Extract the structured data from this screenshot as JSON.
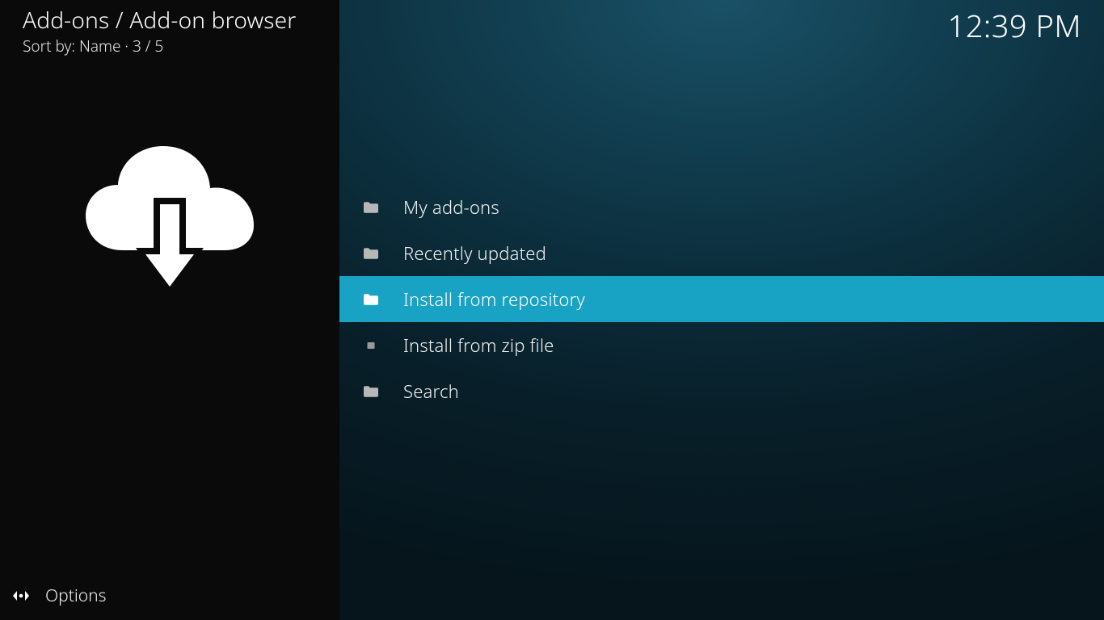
{
  "header": {
    "breadcrumb": "Add-ons / Add-on browser",
    "sort_prefix": "Sort by: ",
    "sort_value": "Name",
    "dot": "  ·  ",
    "position": "3 / 5",
    "clock": "12:39 PM"
  },
  "sidebar": {
    "options_label": "Options"
  },
  "list": {
    "selected_index": 2,
    "items": [
      {
        "label": "My add-ons",
        "icon": "folder"
      },
      {
        "label": "Recently updated",
        "icon": "folder"
      },
      {
        "label": "Install from repository",
        "icon": "folder"
      },
      {
        "label": "Install from zip file",
        "icon": "file"
      },
      {
        "label": "Search",
        "icon": "folder"
      }
    ]
  }
}
